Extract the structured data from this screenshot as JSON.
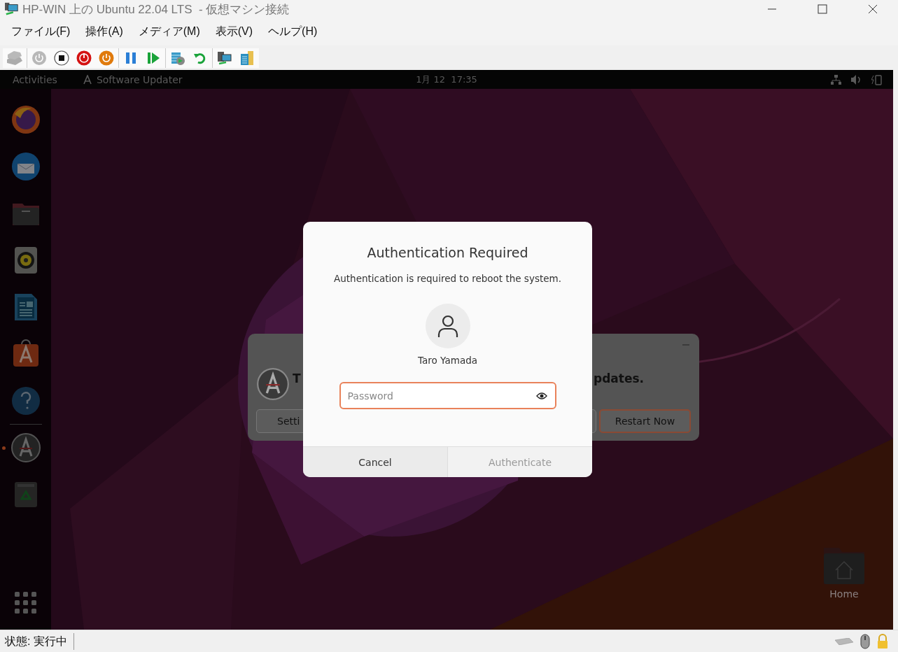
{
  "window": {
    "title": "HP-WIN 上の Ubuntu 22.04 LTS  - 仮想マシン接続"
  },
  "menu": [
    "ファイル(F)",
    "操作(A)",
    "メディア(M)",
    "表示(V)",
    "ヘルプ(H)"
  ],
  "toolbar": [
    [
      {
        "kind": "ctrl-alt-del",
        "disabled": true
      }
    ],
    [
      {
        "kind": "start",
        "disabled": true
      },
      {
        "kind": "turn-off",
        "disabled": false
      },
      {
        "kind": "shut-down",
        "disabled": false
      },
      {
        "kind": "save",
        "disabled": false
      }
    ],
    [
      {
        "kind": "pause",
        "disabled": false
      },
      {
        "kind": "resume",
        "disabled": false
      }
    ],
    [
      {
        "kind": "checkpoint",
        "disabled": false
      },
      {
        "kind": "revert",
        "disabled": false
      }
    ],
    [
      {
        "kind": "enhanced-session",
        "disabled": false
      },
      {
        "kind": "share",
        "disabled": false
      }
    ]
  ],
  "top_bar": {
    "activities": "Activities",
    "app": "Software Updater",
    "clock": "1月 12  17:35"
  },
  "dock": [
    {
      "kind": "firefox",
      "running": false
    },
    {
      "kind": "thunderbird",
      "running": false
    },
    {
      "kind": "files",
      "running": false
    },
    {
      "kind": "rhythmbox",
      "running": false
    },
    {
      "kind": "writer",
      "running": false
    },
    {
      "kind": "app-center",
      "running": false
    },
    {
      "kind": "help",
      "running": false
    },
    {
      "kind": "separator"
    },
    {
      "kind": "updater",
      "running": true
    },
    {
      "kind": "trash",
      "running": false
    }
  ],
  "desktop_icons": [
    {
      "label": "Home"
    }
  ],
  "updater_window": {
    "heading_start": "T",
    "heading_end": "pdates.",
    "buttons": [
      "Setti",
      "Restart Now"
    ]
  },
  "auth_dialog": {
    "title": "Authentication Required",
    "message": "Authentication is required to reboot the system.",
    "user": "Taro Yamada",
    "password": {
      "placeholder": "Password",
      "focused": true
    },
    "buttons": [
      {
        "label": "Cancel",
        "disabled": false
      },
      {
        "label": "Authenticate",
        "disabled": true
      }
    ]
  },
  "status_bar": {
    "text": "状態: 実行中"
  }
}
